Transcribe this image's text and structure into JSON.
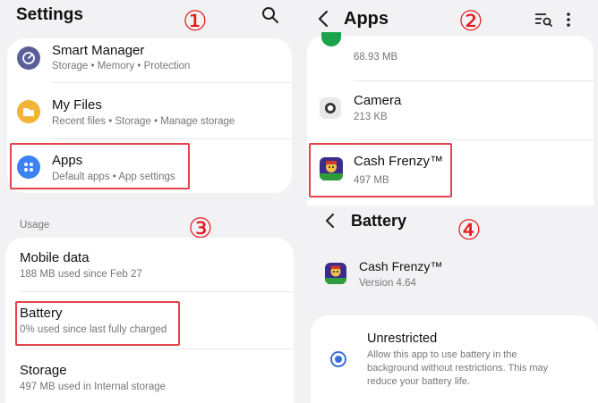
{
  "settings": {
    "title": "Settings",
    "badge": "①",
    "items": [
      {
        "title": "Smart Manager",
        "subtitle": "Storage  •  Memory  •  Protection",
        "icon": "smart-manager-icon"
      },
      {
        "title": "My Files",
        "subtitle": "Recent files  •  Storage  •  Manage storage",
        "icon": "folder-icon"
      },
      {
        "title": "Apps",
        "subtitle": "Default apps  •  App settings",
        "icon": "apps-grid-icon"
      }
    ],
    "colors": {
      "smart_manager": "#5a5f9a",
      "my_files": "#f1b437",
      "apps": "#3b82f6",
      "highlight": "#e2434c"
    }
  },
  "apps": {
    "title": "Apps",
    "badge": "②",
    "items": [
      {
        "title": "",
        "subtitle": "68.93 MB",
        "icon": "green-app-icon"
      },
      {
        "title": "Camera",
        "subtitle": "213 KB",
        "icon": "camera-icon"
      },
      {
        "title": "Cash Frenzy™",
        "subtitle": "497 MB",
        "icon": "cash-frenzy-icon"
      }
    ]
  },
  "usage": {
    "section_label": "Usage",
    "badge": "③",
    "items": [
      {
        "title": "Mobile data",
        "subtitle": "188 MB used since Feb 27"
      },
      {
        "title": "Battery",
        "subtitle": "0% used since last fully charged"
      },
      {
        "title": "Storage",
        "subtitle": "497 MB used in Internal storage"
      }
    ]
  },
  "battery": {
    "title": "Battery",
    "badge": "④",
    "app_name": "Cash Frenzy™",
    "version": "Version 4.64",
    "option_title": "Unrestricted",
    "option_desc_1": "Allow this app to use battery in the",
    "option_desc_2": "background without restrictions. This may",
    "option_desc_3": "reduce your battery life.",
    "option_selected": true
  }
}
